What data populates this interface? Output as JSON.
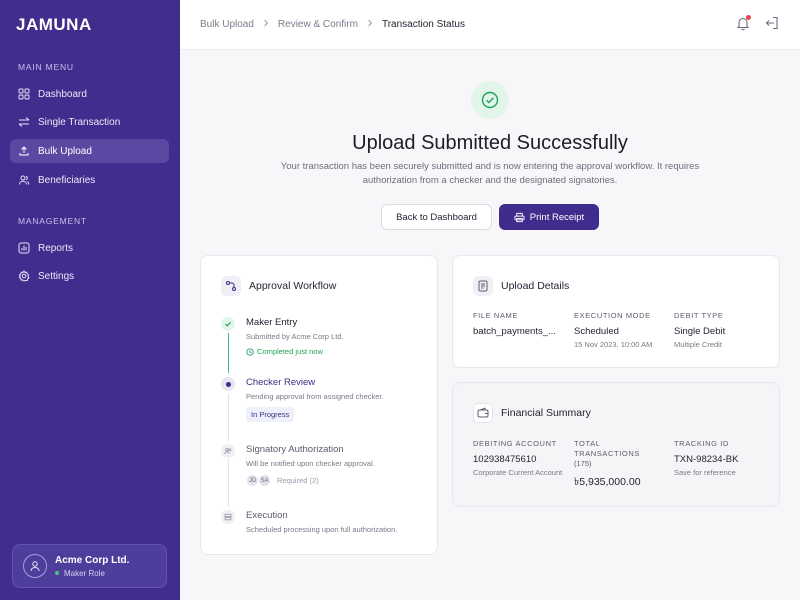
{
  "brand": "JAMUNA",
  "sidebar": {
    "main_menu_label": "MAIN MENU",
    "management_label": "MANAGEMENT",
    "items": [
      {
        "label": "Dashboard",
        "icon": "grid-icon"
      },
      {
        "label": "Single Transaction",
        "icon": "arrows-exchange-icon"
      },
      {
        "label": "Bulk Upload",
        "icon": "upload-icon"
      },
      {
        "label": "Beneficiaries",
        "icon": "users-icon"
      },
      {
        "label": "Reports",
        "icon": "bar-chart-icon"
      },
      {
        "label": "Settings",
        "icon": "gear-icon"
      }
    ],
    "active_item": "Bulk Upload",
    "user": {
      "name": "Acme Corp Ltd.",
      "role": "Maker Role"
    }
  },
  "header": {
    "breadcrumb": [
      "Bulk Upload",
      "Review & Confirm",
      "Transaction Status"
    ]
  },
  "status": {
    "title": "Upload Submitted Successfully",
    "description": "Your transaction has been securely submitted and is now entering the approval workflow. It requires authorization from a checker and the designated signatories.",
    "back_button": "Back to Dashboard",
    "print_button": "Print Receipt"
  },
  "workflow": {
    "title": "Approval Workflow",
    "steps": [
      {
        "name": "Maker Entry",
        "desc": "Submitted by Acme Corp Ltd.",
        "status": "Completed just now"
      },
      {
        "name": "Checker Review",
        "desc": "Pending approval from assigned checker.",
        "status": "In Progress"
      },
      {
        "name": "Signatory Authorization",
        "desc": "Will be notified upon checker approval.",
        "signers": [
          "JD",
          "SA"
        ],
        "status": "Required (2)"
      },
      {
        "name": "Execution",
        "desc": "Scheduled processing upon full authorization."
      }
    ]
  },
  "upload_details": {
    "title": "Upload Details",
    "file_name_label": "FILE NAME",
    "file_name": "batch_payments_...",
    "execution_mode_label": "EXECUTION MODE",
    "execution_mode": "Scheduled",
    "execution_date": "15 Nov 2023, 10:00 AM",
    "debit_type_label": "DEBIT TYPE",
    "debit_type": "Single Debit",
    "debit_type_sub": "Multiple Credit"
  },
  "financial_summary": {
    "title": "Financial Summary",
    "debiting_account_label": "DEBITING ACCOUNT",
    "debiting_account": "102938475610",
    "debiting_account_sub": "Corporate Current Account",
    "total_label": "TOTAL TRANSACTIONS",
    "total_count": "(175)",
    "total_amount": "৳5,935,000.00",
    "tracking_label": "TRACKING ID",
    "tracking_id": "TXN-98234-BK",
    "tracking_sub": "Save for reference"
  },
  "colors": {
    "sidebar": "#412d8e",
    "primary": "#3f2c8c",
    "success": "#23a05d",
    "notification": "#e5484d"
  }
}
